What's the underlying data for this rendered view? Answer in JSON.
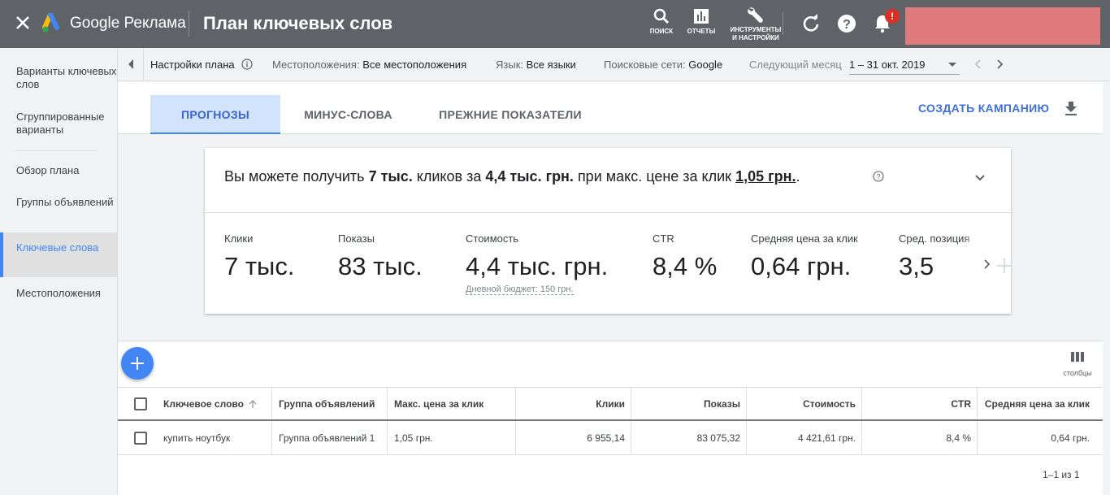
{
  "topbar": {
    "brand": "Google Реклама",
    "title": "План ключевых слов",
    "tools": {
      "search": "ПОИСК",
      "reports": "ОТЧЕТЫ",
      "tools_line1": "ИНСТРУМЕНТЫ",
      "tools_line2": "И НАСТРОЙКИ"
    },
    "notification_badge": "!",
    "account_color": "#e07b7d"
  },
  "sidebar": {
    "items": [
      {
        "label": "Варианты ключевых слов"
      },
      {
        "label": "Сгруппированные варианты"
      },
      {
        "label": "Обзор плана"
      },
      {
        "label": "Группы объявлений"
      },
      {
        "label": "Ключевые слова"
      },
      {
        "label": "Местоположения"
      }
    ],
    "active_index": 4
  },
  "filterbar": {
    "plan_settings": "Настройки плана",
    "locations_label": "Местоположения:",
    "locations_value": "Все местоположения",
    "language_label": "Язык:",
    "language_value": "Все языки",
    "networks_label": "Поисковые сети:",
    "networks_value": "Google",
    "period_label": "Следующий месяц",
    "period_value": "1 – 31 окт. 2019"
  },
  "tabs": [
    {
      "label": "ПРОГНОЗЫ"
    },
    {
      "label": "МИНУС-СЛОВА"
    },
    {
      "label": "ПРЕЖНИЕ ПОКАЗАТЕЛИ"
    }
  ],
  "create_campaign": "СОЗДАТЬ КАМПАНИЮ",
  "forecast": {
    "sentence": {
      "p1": "Вы можете получить ",
      "clicks": "7 тыс.",
      "p2": " кликов за ",
      "cost": "4,4 тыс. грн.",
      "p3": " при макс. цене за клик ",
      "cpc": "1,05 грн.",
      "p4": "."
    },
    "metrics": [
      {
        "label": "Клики",
        "value": "7 тыс."
      },
      {
        "label": "Показы",
        "value": "83 тыс."
      },
      {
        "label": "Стоимость",
        "value": "4,4 тыс. грн.",
        "sub": "Дневной бюджет: 150 грн."
      },
      {
        "label": "CTR",
        "value": "8,4 %"
      },
      {
        "label": "Средняя цена за клик",
        "value": "0,64 грн."
      },
      {
        "label": "Сред. позиция",
        "value": "3,5"
      }
    ]
  },
  "columns_button": "столбцы",
  "table": {
    "headers": [
      "Ключевое слово",
      "Группа объявлений",
      "Макс. цена за клик",
      "Клики",
      "Показы",
      "Стоимость",
      "CTR",
      "Средняя цена за клик"
    ],
    "rows": [
      {
        "keyword": "купить ноутбук",
        "ad_group": "Группа объявлений 1",
        "max_cpc": "1,05 грн.",
        "clicks": "6 955,14",
        "impressions": "83 075,32",
        "cost": "4 421,61 грн.",
        "ctr": "8,4 %",
        "avg_cpc": "0,64 грн."
      }
    ],
    "pagination": "1–1 из 1"
  },
  "colors": {
    "accent": "#4285f4",
    "topbar": "#5f6368",
    "tab_active_bg": "#d2e3fc"
  }
}
